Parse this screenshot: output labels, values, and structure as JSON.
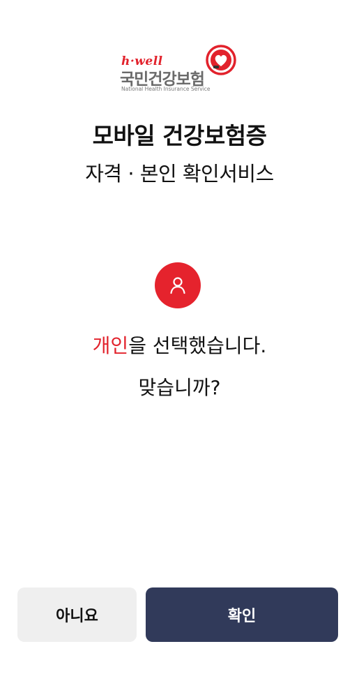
{
  "logo": {
    "brand": "h·well",
    "org_name_kr": "국민건강보험",
    "org_name_en": "National Health Insurance Service",
    "icon": "heart-badge-icon",
    "accent_color": "#e2222c"
  },
  "header": {
    "title": "모바일 건강보험증",
    "subtitle": "자격 · 본인 확인서비스"
  },
  "selection": {
    "icon": "person-icon",
    "icon_bg_color": "#e5232d",
    "selected_type": "개인",
    "message_rest": "을 선택했습니다.",
    "question": "맞습니까?"
  },
  "buttons": {
    "no_label": "아니요",
    "yes_label": "확인",
    "no_bg_color": "#efefef",
    "yes_bg_color": "#313a5a"
  }
}
